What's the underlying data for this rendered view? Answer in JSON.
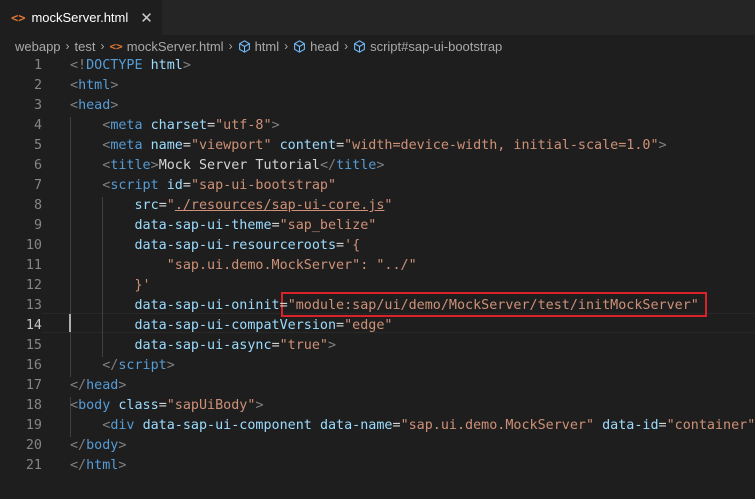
{
  "tab": {
    "label": "mockServer.html",
    "icon": "html-file-icon",
    "close_glyph": "✕"
  },
  "breadcrumb": {
    "items": [
      "webapp",
      "test",
      "mockServer.html",
      "html",
      "head",
      "script#sap-ui-bootstrap"
    ]
  },
  "editor": {
    "active_line": 14,
    "line_numbers": [
      "1",
      "2",
      "3",
      "4",
      "5",
      "6",
      "7",
      "8",
      "9",
      "10",
      "11",
      "12",
      "13",
      "14",
      "15",
      "16",
      "17",
      "18",
      "19",
      "20",
      "21"
    ],
    "lines": [
      [
        [
          "t-punc",
          "<!"
        ],
        [
          "t-tag",
          "DOCTYPE"
        ],
        [
          "t-text",
          " "
        ],
        [
          "t-attr",
          "html"
        ],
        [
          "t-punc",
          ">"
        ]
      ],
      [
        [
          "t-punc",
          "<"
        ],
        [
          "t-tag",
          "html"
        ],
        [
          "t-punc",
          ">"
        ]
      ],
      [
        [
          "t-punc",
          "<"
        ],
        [
          "t-tag",
          "head"
        ],
        [
          "t-punc",
          ">"
        ]
      ],
      [
        [
          "t-text",
          "    "
        ],
        [
          "t-punc",
          "<"
        ],
        [
          "t-tag",
          "meta"
        ],
        [
          "t-text",
          " "
        ],
        [
          "t-attr",
          "charset"
        ],
        [
          "t-text",
          "="
        ],
        [
          "t-str",
          "\"utf-8\""
        ],
        [
          "t-punc",
          ">"
        ]
      ],
      [
        [
          "t-text",
          "    "
        ],
        [
          "t-punc",
          "<"
        ],
        [
          "t-tag",
          "meta"
        ],
        [
          "t-text",
          " "
        ],
        [
          "t-attr",
          "name"
        ],
        [
          "t-text",
          "="
        ],
        [
          "t-str",
          "\"viewport\""
        ],
        [
          "t-text",
          " "
        ],
        [
          "t-attr",
          "content"
        ],
        [
          "t-text",
          "="
        ],
        [
          "t-str",
          "\"width=device-width, initial-scale=1.0\""
        ],
        [
          "t-punc",
          ">"
        ]
      ],
      [
        [
          "t-text",
          "    "
        ],
        [
          "t-punc",
          "<"
        ],
        [
          "t-tag",
          "title"
        ],
        [
          "t-punc",
          ">"
        ],
        [
          "t-text",
          "Mock Server Tutorial"
        ],
        [
          "t-punc",
          "</"
        ],
        [
          "t-tag",
          "title"
        ],
        [
          "t-punc",
          ">"
        ]
      ],
      [
        [
          "t-text",
          "    "
        ],
        [
          "t-punc",
          "<"
        ],
        [
          "t-tag",
          "script"
        ],
        [
          "t-text",
          " "
        ],
        [
          "t-attr",
          "id"
        ],
        [
          "t-text",
          "="
        ],
        [
          "t-str",
          "\"sap-ui-bootstrap\""
        ]
      ],
      [
        [
          "t-text",
          "        "
        ],
        [
          "t-attr",
          "src"
        ],
        [
          "t-text",
          "="
        ],
        [
          "t-str",
          "\""
        ],
        [
          "t-link",
          "./resources/sap-ui-core.js"
        ],
        [
          "t-str",
          "\""
        ]
      ],
      [
        [
          "t-text",
          "        "
        ],
        [
          "t-attr",
          "data-sap-ui-theme"
        ],
        [
          "t-text",
          "="
        ],
        [
          "t-str",
          "\"sap_belize\""
        ]
      ],
      [
        [
          "t-text",
          "        "
        ],
        [
          "t-attr",
          "data-sap-ui-resourceroots"
        ],
        [
          "t-text",
          "="
        ],
        [
          "t-str",
          "'{"
        ]
      ],
      [
        [
          "t-text",
          "            "
        ],
        [
          "t-str",
          "\"sap.ui.demo.MockServer\": \"../\""
        ]
      ],
      [
        [
          "t-text",
          "        "
        ],
        [
          "t-str",
          "}'"
        ]
      ],
      [
        [
          "t-text",
          "        "
        ],
        [
          "t-attr",
          "data-sap-ui-oninit"
        ],
        [
          "t-text",
          "="
        ],
        [
          "t-str",
          "\"module:sap/ui/demo/MockServer/test/initMockServer\""
        ]
      ],
      [
        [
          "t-text",
          "        "
        ],
        [
          "t-attr",
          "data-sap-ui-compatVersion"
        ],
        [
          "t-text",
          "="
        ],
        [
          "t-str",
          "\"edge\""
        ]
      ],
      [
        [
          "t-text",
          "        "
        ],
        [
          "t-attr",
          "data-sap-ui-async"
        ],
        [
          "t-text",
          "="
        ],
        [
          "t-str",
          "\"true\""
        ],
        [
          "t-punc",
          ">"
        ]
      ],
      [
        [
          "t-text",
          "    "
        ],
        [
          "t-punc",
          "</"
        ],
        [
          "t-tag",
          "script"
        ],
        [
          "t-punc",
          ">"
        ]
      ],
      [
        [
          "t-punc",
          "</"
        ],
        [
          "t-tag",
          "head"
        ],
        [
          "t-punc",
          ">"
        ]
      ],
      [
        [
          "t-punc",
          "<"
        ],
        [
          "t-tag",
          "body"
        ],
        [
          "t-text",
          " "
        ],
        [
          "t-attr",
          "class"
        ],
        [
          "t-text",
          "="
        ],
        [
          "t-str",
          "\"sapUiBody\""
        ],
        [
          "t-punc",
          ">"
        ]
      ],
      [
        [
          "t-text",
          "    "
        ],
        [
          "t-punc",
          "<"
        ],
        [
          "t-tag",
          "div"
        ],
        [
          "t-text",
          " "
        ],
        [
          "t-attr",
          "data-sap-ui-component"
        ],
        [
          "t-text",
          " "
        ],
        [
          "t-attr",
          "data-name"
        ],
        [
          "t-text",
          "="
        ],
        [
          "t-str",
          "\"sap.ui.demo.MockServer\""
        ],
        [
          "t-text",
          " "
        ],
        [
          "t-attr",
          "data-id"
        ],
        [
          "t-text",
          "="
        ],
        [
          "t-str",
          "\"container\""
        ]
      ],
      [
        [
          "t-punc",
          "</"
        ],
        [
          "t-tag",
          "body"
        ],
        [
          "t-punc",
          ">"
        ]
      ],
      [
        [
          "t-punc",
          "</"
        ],
        [
          "t-tag",
          "html"
        ],
        [
          "t-punc",
          ">"
        ]
      ]
    ]
  }
}
